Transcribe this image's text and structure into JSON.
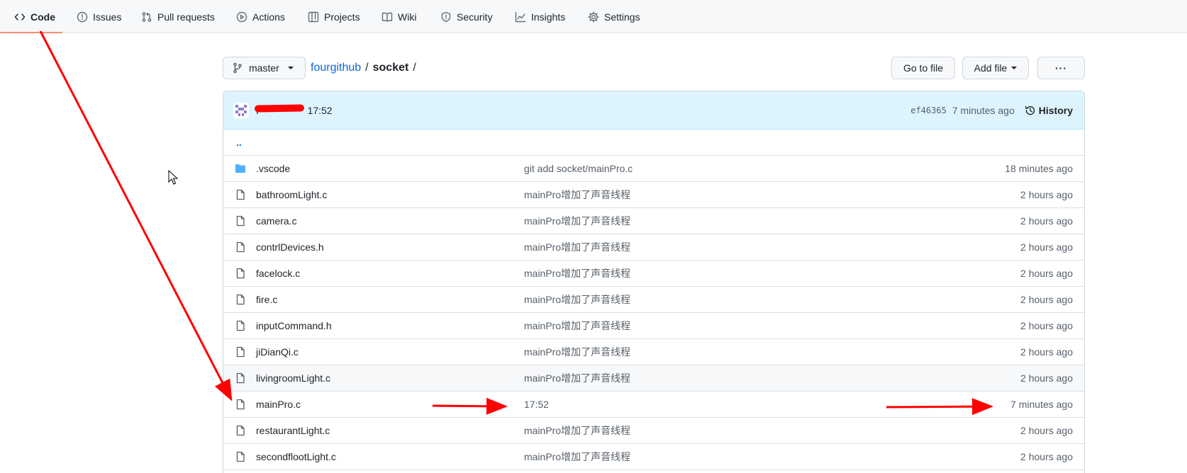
{
  "nav": {
    "items": [
      {
        "label": "Code",
        "icon": "code-icon",
        "selected": true
      },
      {
        "label": "Issues",
        "icon": "issue-icon"
      },
      {
        "label": "Pull requests",
        "icon": "pull-request-icon"
      },
      {
        "label": "Actions",
        "icon": "play-icon"
      },
      {
        "label": "Projects",
        "icon": "table-icon"
      },
      {
        "label": "Wiki",
        "icon": "book-icon"
      },
      {
        "label": "Security",
        "icon": "shield-icon"
      },
      {
        "label": "Insights",
        "icon": "graph-icon"
      },
      {
        "label": "Settings",
        "icon": "gear-icon"
      }
    ]
  },
  "branch": {
    "name": "master",
    "icon": "git-branch-icon"
  },
  "breadcrumb": {
    "repo": "fourgithub",
    "separator": "/",
    "dir": "socket",
    "trailing": "/"
  },
  "toolbar": {
    "go_to_file": "Go to file",
    "add_file": "Add file",
    "more": "···"
  },
  "commit": {
    "author": "F",
    "message": "17:52",
    "sha": "ef46365",
    "time": "7 minutes ago",
    "history_label": "History"
  },
  "up_label": "..",
  "files": [
    {
      "name": ".vscode",
      "type": "dir",
      "message": "git add socket/mainPro.c",
      "age": "18 minutes ago"
    },
    {
      "name": "bathroomLight.c",
      "type": "file",
      "message": "mainPro增加了声音线程",
      "age": "2 hours ago"
    },
    {
      "name": "camera.c",
      "type": "file",
      "message": "mainPro增加了声音线程",
      "age": "2 hours ago"
    },
    {
      "name": "contrlDevices.h",
      "type": "file",
      "message": "mainPro增加了声音线程",
      "age": "2 hours ago"
    },
    {
      "name": "facelock.c",
      "type": "file",
      "message": "mainPro增加了声音线程",
      "age": "2 hours ago"
    },
    {
      "name": "fire.c",
      "type": "file",
      "message": "mainPro增加了声音线程",
      "age": "2 hours ago"
    },
    {
      "name": "inputCommand.h",
      "type": "file",
      "message": "mainPro增加了声音线程",
      "age": "2 hours ago"
    },
    {
      "name": "jiDianQi.c",
      "type": "file",
      "message": "mainPro增加了声音线程",
      "age": "2 hours ago"
    },
    {
      "name": "livingroomLight.c",
      "type": "file",
      "message": "mainPro增加了声音线程",
      "age": "2 hours ago"
    },
    {
      "name": "mainPro.c",
      "type": "file",
      "message": "17:52",
      "age": "7 minutes ago"
    },
    {
      "name": "restaurantLight.c",
      "type": "file",
      "message": "mainPro增加了声音线程",
      "age": "2 hours ago"
    },
    {
      "name": "secondflootLight.c",
      "type": "file",
      "message": "mainPro增加了声音线程",
      "age": "2 hours ago"
    }
  ],
  "colors": {
    "accent": "#0969da",
    "annotation": "#ff0000",
    "selected_underline": "#fd8c73"
  }
}
